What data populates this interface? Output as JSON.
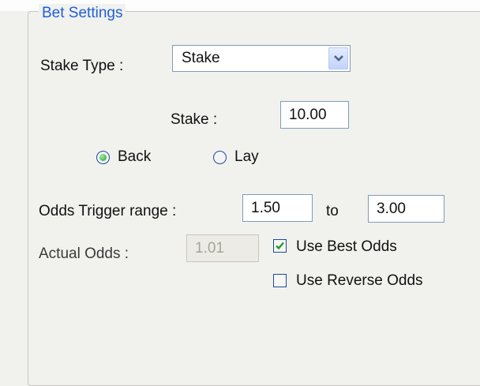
{
  "group": {
    "title": "Bet Settings"
  },
  "stake_type": {
    "label": "Stake Type :",
    "selected": "Stake"
  },
  "stake": {
    "label": "Stake :",
    "value": "10.00"
  },
  "side": {
    "options": [
      {
        "label": "Back",
        "checked": true
      },
      {
        "label": "Lay",
        "checked": false
      }
    ]
  },
  "odds_trigger": {
    "label": "Odds Trigger range :",
    "from": "1.50",
    "separator": "to",
    "to": "3.00"
  },
  "actual_odds": {
    "label": "Actual Odds :",
    "value": "1.01",
    "enabled": false
  },
  "use_best_odds": {
    "label": "Use Best Odds",
    "checked": true
  },
  "use_reverse_odds": {
    "label": "Use Reverse Odds",
    "checked": false
  },
  "colors": {
    "legend": "#1f5fd9",
    "radio_dot": "#1ca02a",
    "check_mark": "#1ca02a"
  },
  "icons": {
    "dropdown": "chevron-down-icon",
    "check": "checkmark-icon"
  }
}
